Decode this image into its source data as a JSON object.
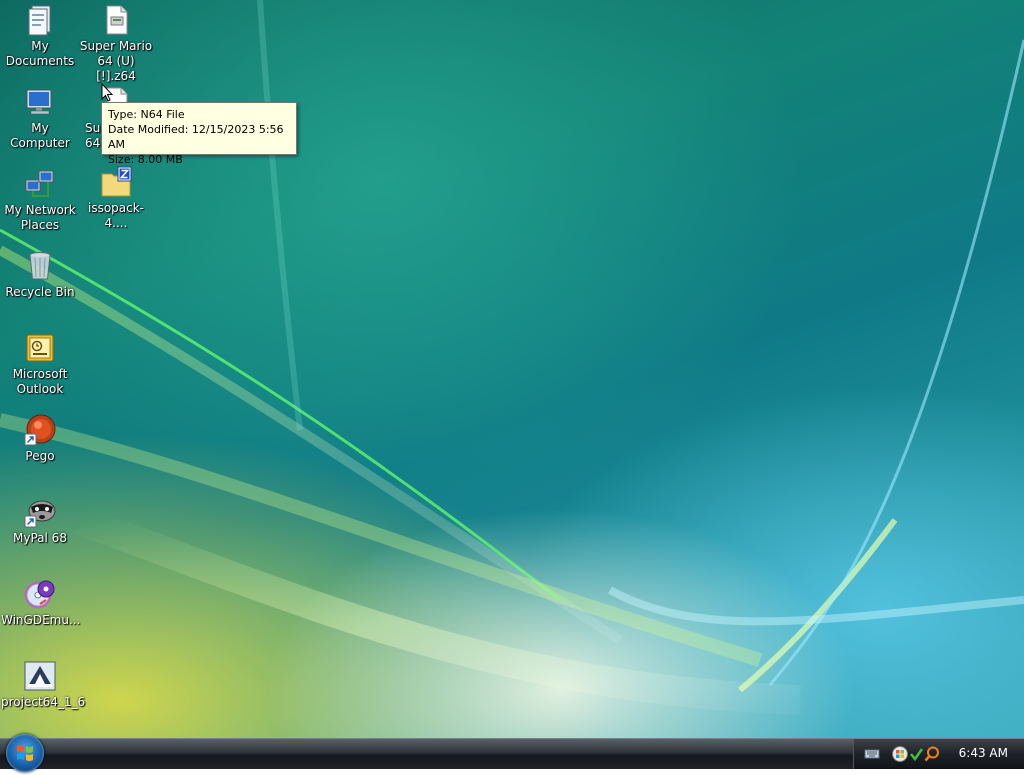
{
  "desktop": {
    "icons": [
      {
        "label": "My\nDocuments"
      },
      {
        "label": "Super Mario\n64 (U) [!].z64"
      },
      {
        "label": "My Computer"
      },
      {
        "label": "Sup…\n64…"
      },
      {
        "label": "My Network\nPlaces"
      },
      {
        "label": "issopack-4...."
      },
      {
        "label": "Recycle Bin"
      },
      {
        "label": "Microsoft\nOutlook"
      },
      {
        "label": "Pego"
      },
      {
        "label": "MyPal 68"
      },
      {
        "label": "WinGDEmu..."
      },
      {
        "label": "project64_1_6"
      }
    ]
  },
  "tooltip": {
    "type": "Type: N64 File",
    "date_modified": "Date Modified: 12/15/2023 5:56 AM",
    "size": "Size: 8.00 MB"
  },
  "taskbar": {
    "clock": "6:43 AM",
    "tray_icons": [
      "keyboard-icon",
      "windows-flag-icon",
      "security-check-icon",
      "search-icon"
    ]
  },
  "colors": {
    "tooltip_bg": "#ffffe1",
    "taskbar_bg": "#1f2328"
  }
}
